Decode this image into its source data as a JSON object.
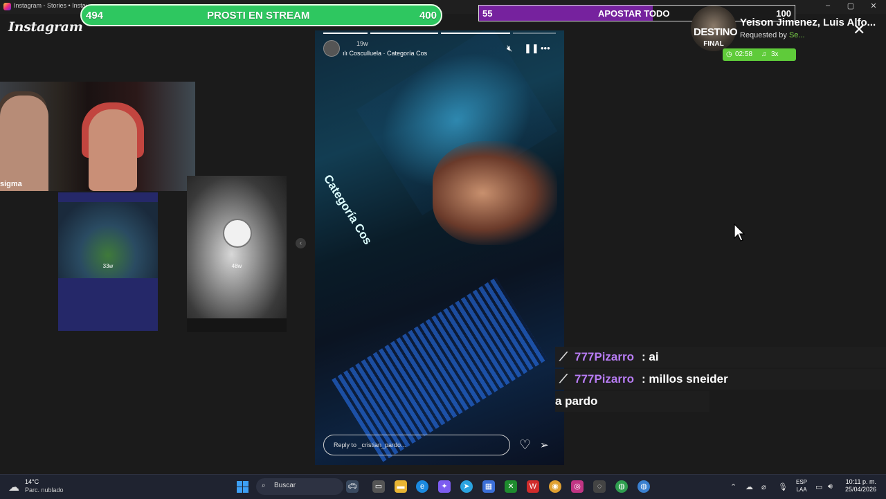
{
  "browser": {
    "tab_title": "Instagram - Stories • Instagr",
    "minimize": "–",
    "restore": "▢",
    "close": "✕"
  },
  "instagram": {
    "logo": "Instagram"
  },
  "poll": {
    "label": "PROSTI EN STREAM",
    "left_value": "494",
    "right_value": "400",
    "color": "#2ec760"
  },
  "bet": {
    "label": "APOSTAR TODO",
    "left_value": "55",
    "right_value": "100",
    "fill_fraction": 0.55,
    "color": "#76229e"
  },
  "song": {
    "album_title_1": "DESTINO",
    "album_title_2": "FINAL",
    "title": "Yeison Jimenez, Luis Alfo...",
    "requested_by_label": "Requested by",
    "requested_by_user": "Se...",
    "duration": "02:58",
    "multiplier": "3x"
  },
  "webcam": {
    "overlay_tag": "sigma"
  },
  "thumbs": [
    {
      "age": "33w"
    },
    {
      "age": "48w"
    }
  ],
  "story": {
    "age": "19w",
    "audio": "Cosculluela · Categoría Cos",
    "overlay_text": "Categoría Cos",
    "reply_placeholder": "Reply to _cristian_pardo..."
  },
  "chat": [
    {
      "user": "777Pizarro",
      "message": ": ai"
    },
    {
      "user": "777Pizarro",
      "message": ": millos sneider"
    },
    {
      "user": "",
      "message": "a pardo"
    }
  ],
  "taskbar": {
    "temperature": "14°C",
    "weather": "Parc. nublado",
    "search_placeholder": "Buscar",
    "lang_1": "ESP",
    "lang_2": "LAA",
    "time": "10:11 p. m.",
    "date": "25/04/2026"
  }
}
